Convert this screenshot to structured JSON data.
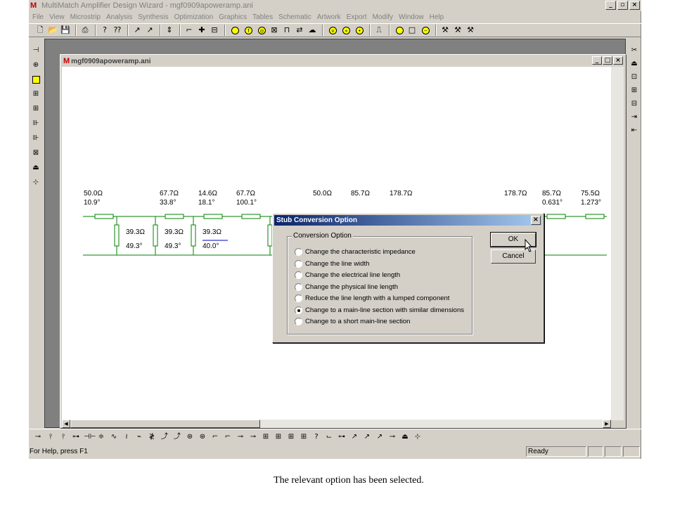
{
  "app": {
    "title": "MultiMatch Amplifier Design Wizard - mgf0909apoweramp.ani",
    "window_buttons": [
      "_",
      "▫",
      "×"
    ]
  },
  "menu": [
    "File",
    "View",
    "Microstrip",
    "Analysis",
    "Synthesis",
    "Optimization",
    "Graphics",
    "Tables",
    "Schematic",
    "Artwork",
    "Export",
    "Modify",
    "Window",
    "Help"
  ],
  "child_window": {
    "title": "mgf0909apoweramp.ani"
  },
  "schematic": {
    "line_labels": [
      {
        "z": "50.0Ω",
        "e": "10.9°"
      },
      {
        "z": "67.7Ω",
        "e": "33.8°"
      },
      {
        "z": "14.6Ω",
        "e": "18.1°"
      },
      {
        "z": "67.7Ω",
        "e": "100.1°"
      },
      {
        "z": "50.0Ω",
        "e": ""
      },
      {
        "z": "85.7Ω",
        "e": ""
      },
      {
        "z": "178.7Ω",
        "e": ""
      },
      {
        "z": "178.7Ω",
        "e": ""
      },
      {
        "z": "85.7Ω",
        "e": "0.631°"
      },
      {
        "z": "75.5Ω",
        "e": "1.273°"
      }
    ],
    "stub_labels": [
      {
        "z": "39.3Ω",
        "e": "49.3°"
      },
      {
        "z": "39.3Ω",
        "e": "49.3°"
      },
      {
        "z": "39.3Ω",
        "e": "40.0°"
      }
    ]
  },
  "dialog": {
    "title": "Stub Conversion Option",
    "group_label": "Conversion Option",
    "options": [
      "Change the characteristic impedance",
      "Change the line width",
      "Change the electrical line length",
      "Change the physical line length",
      "Reduce the line length with a lumped component",
      "Change to a main-line section with similar dimensions",
      "Change to a short main-line section"
    ],
    "selected_index": 5,
    "ok_label": "OK",
    "cancel_label": "Cancel"
  },
  "status": {
    "help": "For Help, press F1",
    "state": "Ready"
  },
  "caption": "The relevant option has been selected.",
  "colors": {
    "dialog_title_start": "#0a246a",
    "dialog_title_end": "#a6caf0",
    "circuit_green": "#008000",
    "app_logo": "#c00000"
  }
}
